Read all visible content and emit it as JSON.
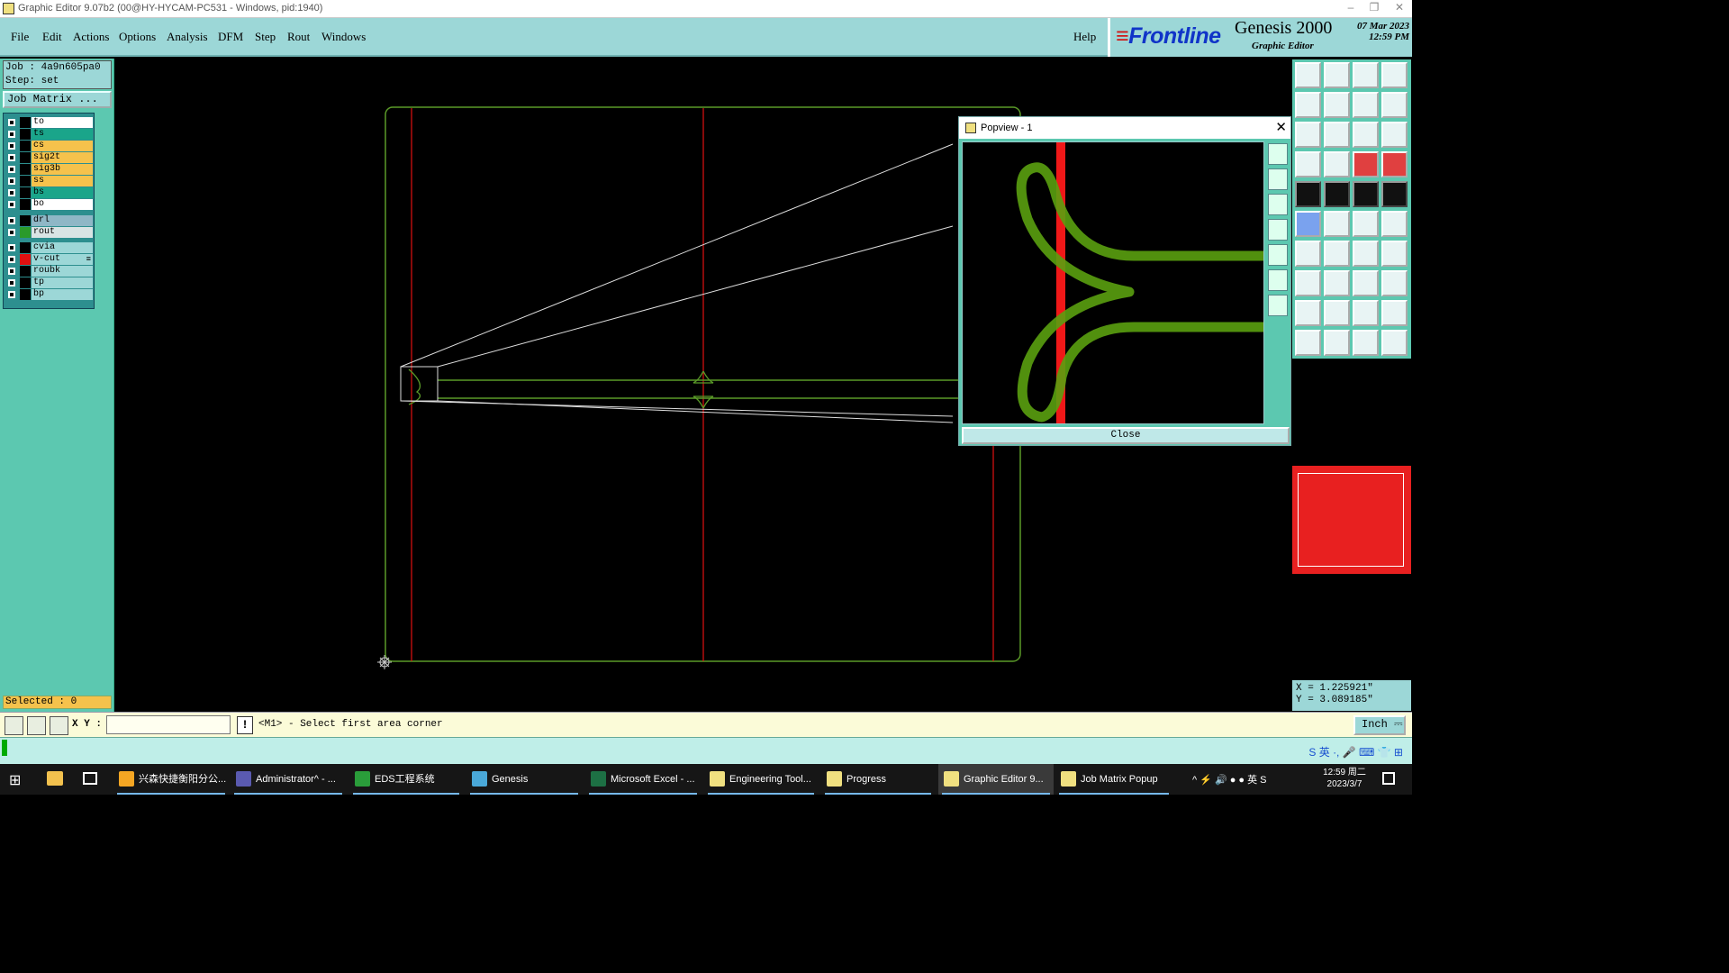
{
  "window": {
    "title": "Graphic Editor 9.07b2 (00@HY-HYCAM-PC531 - Windows, pid:1940)",
    "controls": [
      "–",
      "❐",
      "✕"
    ]
  },
  "menu": {
    "items": [
      "File",
      "Edit",
      "Actions",
      "Options",
      "Analysis",
      "DFM",
      "Step",
      "Rout",
      "Windows"
    ],
    "help": "Help"
  },
  "brand": {
    "logo": "Frontline",
    "product": "Genesis 2000",
    "subtitle": "Graphic Editor",
    "date": "07 Mar 2023",
    "time": "12:59 PM"
  },
  "job": {
    "job_line": "Job : 4a9n605pa0",
    "step_line": "Step: set",
    "matrix_button": "Job Matrix ..."
  },
  "layers": [
    {
      "name": "to",
      "color": "#ffffff"
    },
    {
      "name": "ts",
      "color": "#1aa58a"
    },
    {
      "name": "cs",
      "color": "#f5c24c"
    },
    {
      "name": "sig2t",
      "color": "#f5c24c"
    },
    {
      "name": "sig3b",
      "color": "#f5c24c"
    },
    {
      "name": "ss",
      "color": "#f5c24c"
    },
    {
      "name": "bs",
      "color": "#1aa58a"
    },
    {
      "name": "bo",
      "color": "#ffffff"
    },
    {
      "name": "drl",
      "color": "#8fb7c6"
    },
    {
      "name": "rout",
      "color": "#d9e4e4"
    },
    {
      "name": "cvia",
      "color": "#9cd7d7"
    },
    {
      "name": "v-cut",
      "color": "#9cd7d7",
      "mark": "≡"
    },
    {
      "name": "roubk",
      "color": "#9cd7d7"
    },
    {
      "name": "tp",
      "color": "#9cd7d7"
    },
    {
      "name": "bp",
      "color": "#9cd7d7"
    }
  ],
  "selected_text": "Selected : 0",
  "popview": {
    "title": "Popview - 1",
    "close_button": "Close",
    "close_glyph": "✕"
  },
  "coords": {
    "x": "X = 1.225921\"",
    "y": "Y = 3.089185\""
  },
  "command": {
    "xy_label": "X Y :",
    "xy_value": "",
    "excl": "!",
    "message": "<M1> - Select first area corner",
    "unit": "Inch ⎓"
  },
  "ime": "S 英 ·, 🎤 ⌨ 👕 ⊞",
  "taskbar": {
    "apps": [
      {
        "label": "兴森快捷衡阳分公...",
        "color": "#f5a623"
      },
      {
        "label": "Administrator^ - ...",
        "color": "#5a5ab0"
      },
      {
        "label": "EDS工程系统",
        "color": "#2a9d3a"
      },
      {
        "label": "Genesis",
        "color": "#4aa8d8"
      },
      {
        "label": "Microsoft Excel - ...",
        "color": "#1d7044"
      },
      {
        "label": "Engineering Tool...",
        "color": "#f0e080"
      },
      {
        "label": "Progress",
        "color": "#f0e080"
      },
      {
        "label": "Graphic Editor 9...",
        "color": "#f0e080"
      },
      {
        "label": "Job Matrix Popup",
        "color": "#f0e080"
      }
    ],
    "tray": "^ ⚡ 🔊 ● ● 英 S",
    "clock_time": "12:59 周二",
    "clock_date": "2023/3/7"
  }
}
